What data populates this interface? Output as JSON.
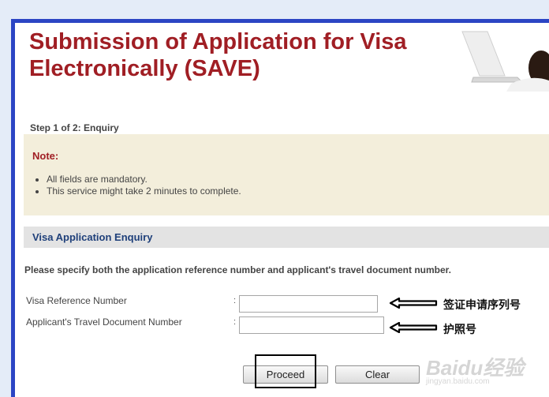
{
  "header": {
    "title": "Submission of Application for Visa Electronically (SAVE)"
  },
  "step": "Step 1 of 2: Enquiry",
  "note": {
    "title": "Note:",
    "items": [
      "All fields are mandatory.",
      "This service might take 2 minutes to complete."
    ]
  },
  "section": {
    "title": "Visa Application Enquiry"
  },
  "instructions": "Please specify both the application reference number and applicant's travel document number.",
  "form": {
    "visa_ref_label": "Visa Reference Number",
    "visa_ref_value": "",
    "travel_doc_label": "Applicant's Travel Document Number",
    "travel_doc_value": "",
    "colon": ":"
  },
  "annotations": {
    "visa_ref_cn": "签证申请序列号",
    "travel_doc_cn": "护照号"
  },
  "buttons": {
    "proceed": "Proceed",
    "clear": "Clear"
  },
  "watermark": {
    "brand": "Baidu经验",
    "url": "jingyan.baidu.com"
  },
  "colors": {
    "title": "#a01e24",
    "frame_border": "#2b45c4",
    "note_bg": "#f3eedb",
    "section_bg": "#e3e3e3",
    "section_title": "#1e3f7a"
  }
}
